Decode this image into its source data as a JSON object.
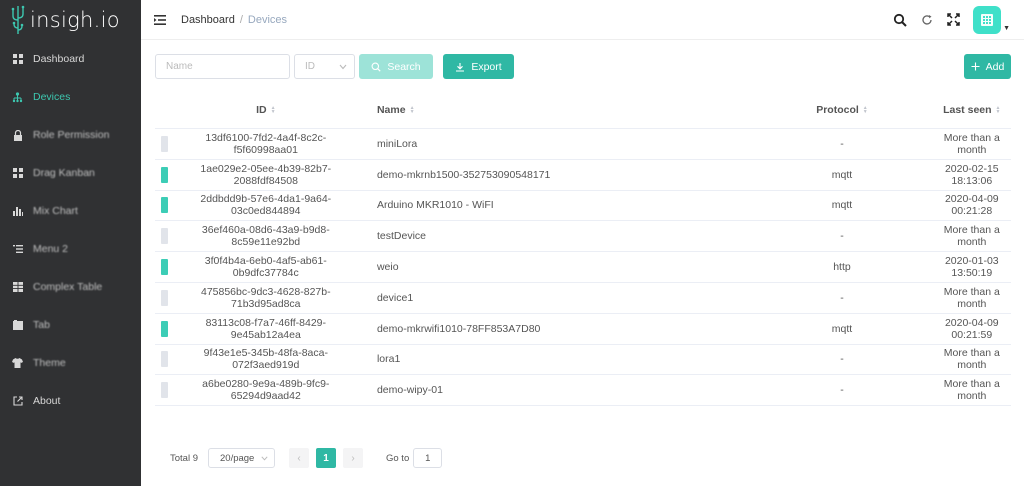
{
  "app": {
    "logo_text": "insigh.io"
  },
  "sidebar": {
    "items": [
      {
        "label": "Dashboard",
        "icon": "dashboard-icon"
      },
      {
        "label": "Devices",
        "icon": "devices-icon"
      },
      {
        "label": "Role Permission",
        "icon": "lock-icon"
      },
      {
        "label": "Drag Kanban",
        "icon": "kanban-icon"
      },
      {
        "label": "Mix Chart",
        "icon": "chart-icon"
      },
      {
        "label": "Menu 2",
        "icon": "menu-icon"
      },
      {
        "label": "Complex Table",
        "icon": "table-icon"
      },
      {
        "label": "Tab",
        "icon": "tab-icon"
      },
      {
        "label": "Theme",
        "icon": "shirt-icon"
      },
      {
        "label": "About",
        "icon": "external-link-icon"
      }
    ],
    "active_index": 1,
    "accent": "#3dc7b0"
  },
  "header": {
    "breadcrumb": {
      "first": "Dashboard",
      "sep": "/",
      "current": "Devices"
    }
  },
  "toolbar": {
    "name_placeholder": "Name",
    "id_select": "ID",
    "search_label": "Search",
    "export_label": "Export",
    "add_label": "Add"
  },
  "table": {
    "headers": {
      "id": "ID",
      "name": "Name",
      "protocol": "Protocol",
      "last_seen": "Last seen"
    },
    "rows": [
      {
        "id": "13df6100-7fd2-4a4f-8c2c-f5f60998aa01",
        "name": "miniLora",
        "protocol": "-",
        "last_seen": "More than a month",
        "online": false
      },
      {
        "id": "1ae029e2-05ee-4b39-82b7-2088fdf84508",
        "name": "demo-mkrnb1500-352753090548171",
        "protocol": "mqtt",
        "last_seen": "2020-02-15 18:13:06",
        "online": true
      },
      {
        "id": "2ddbdd9b-57e6-4da1-9a64-03c0ed844894",
        "name": "Arduino MKR1010 - WiFI",
        "protocol": "mqtt",
        "last_seen": "2020-04-09 00:21:28",
        "online": true
      },
      {
        "id": "36ef460a-08d6-43a9-b9d8-8c59e11e92bd",
        "name": "testDevice",
        "protocol": "-",
        "last_seen": "More than a month",
        "online": false
      },
      {
        "id": "3f0f4b4a-6eb0-4af5-ab61-0b9dfc37784c",
        "name": "weio",
        "protocol": "http",
        "last_seen": "2020-01-03 13:50:19",
        "online": true
      },
      {
        "id": "475856bc-9dc3-4628-827b-71b3d95ad8ca",
        "name": "device1",
        "protocol": "-",
        "last_seen": "More than a month",
        "online": false
      },
      {
        "id": "83113c08-f7a7-46ff-8429-9e45ab12a4ea",
        "name": "demo-mkrwifi1010-78FF853A7D80",
        "protocol": "mqtt",
        "last_seen": "2020-04-09 00:21:59",
        "online": true
      },
      {
        "id": "9f43e1e5-345b-48fa-8aca-072f3aed919d",
        "name": "lora1",
        "protocol": "-",
        "last_seen": "More than a month",
        "online": false
      },
      {
        "id": "a6be0280-9e9a-489b-9fc9-65294d9aad42",
        "name": "demo-wipy-01",
        "protocol": "-",
        "last_seen": "More than a month",
        "online": false
      }
    ],
    "online_color": "#3ccdb6",
    "offline_color": "#e1e4ea"
  },
  "pagination": {
    "total": "Total 9",
    "page_size": "20/page",
    "prev": "‹",
    "current_page": "1",
    "next": "›",
    "goto_label": "Go to",
    "goto_value": "1"
  }
}
